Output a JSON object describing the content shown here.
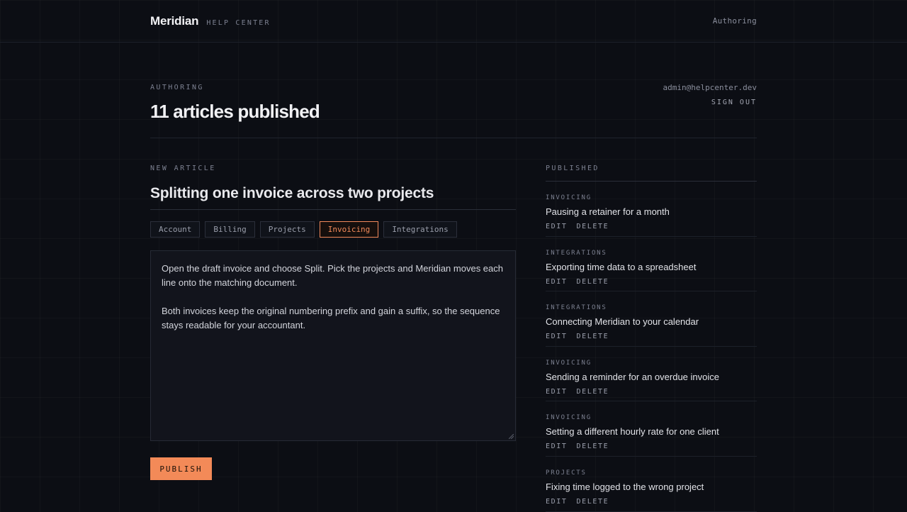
{
  "brand": {
    "name": "Meridian",
    "subtitle": "HELP CENTER"
  },
  "nav": {
    "right_link": "Authoring"
  },
  "header": {
    "eyebrow": "AUTHORING",
    "title": "11 articles published",
    "email": "admin@helpcenter.dev",
    "sign_out": "SIGN OUT"
  },
  "composer": {
    "eyebrow": "NEW ARTICLE",
    "title_value": "Splitting one invoice across two projects",
    "categories": [
      "Account",
      "Billing",
      "Projects",
      "Invoicing",
      "Integrations"
    ],
    "selected_category": "Invoicing",
    "body_paragraphs": [
      "Open the draft invoice and choose Split. Pick the projects and Meridian moves each line onto the matching document.",
      "Both invoices keep the original numbering prefix and gain a suffix, so the sequence stays readable for your accountant."
    ],
    "publish_label": "PUBLISH"
  },
  "published": {
    "eyebrow": "PUBLISHED",
    "edit_label": "EDIT",
    "delete_label": "DELETE",
    "items": [
      {
        "category": "INVOICING",
        "title": "Pausing a retainer for a month"
      },
      {
        "category": "INTEGRATIONS",
        "title": "Exporting time data to a spreadsheet"
      },
      {
        "category": "INTEGRATIONS",
        "title": "Connecting Meridian to your calendar"
      },
      {
        "category": "INVOICING",
        "title": "Sending a reminder for an overdue invoice"
      },
      {
        "category": "INVOICING",
        "title": "Setting a different hourly rate for one client"
      },
      {
        "category": "PROJECTS",
        "title": "Fixing time logged to the wrong project"
      }
    ]
  },
  "colors": {
    "accent": "#f38a58",
    "background": "#0c0e14"
  }
}
